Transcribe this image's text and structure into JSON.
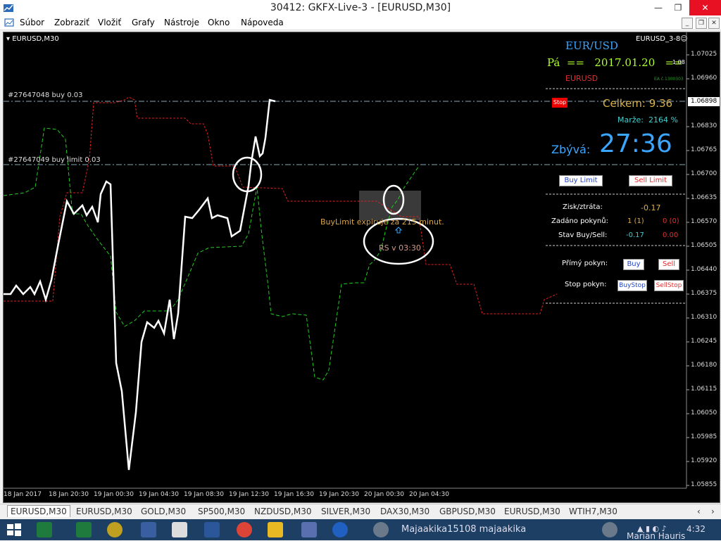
{
  "window": {
    "title": "30412: GKFX-Live-3 - [EURUSD,M30]",
    "minimize": "—",
    "restore": "❐",
    "close": "✕"
  },
  "menu": [
    "Súbor",
    "Zobraziť",
    "Vložiť",
    "Grafy",
    "Nástroje",
    "Okno",
    "Nápoveda"
  ],
  "chart": {
    "symbol_label": "EURUSD,M30",
    "ea_name": "EURUSD_3-8☺",
    "order1": "#27647048 buy 0.03",
    "order2": "#27647049 buy limit 0.03",
    "current_price": "1.06898",
    "stop_label": "Stop",
    "expiry_text": "BuyLimit expiruje za 215 minut.",
    "rs_text": "RS v 03:30",
    "colors": {
      "white_line": "#ffffff",
      "green_line": "#22cc22",
      "red_line": "#dd2222"
    }
  },
  "price_axis": [
    "1.07025",
    "1.06960",
    "1.06898",
    "1.06830",
    "1.06765",
    "1.06700",
    "1.06635",
    "1.06570",
    "1.06505",
    "1.06440",
    "1.06375",
    "1.06310",
    "1.06245",
    "1.06180",
    "1.06115",
    "1.06050",
    "1.05985",
    "1.05920",
    "1.05855"
  ],
  "time_axis": [
    "18 Jan 2017",
    "18 Jan 20:30",
    "19 Jan 00:30",
    "19 Jan 04:30",
    "19 Jan 08:30",
    "19 Jan 12:30",
    "19 Jan 16:30",
    "19 Jan 20:30",
    "20 Jan 00:30",
    "20 Jan 04:30"
  ],
  "panel": {
    "pair": "EUR/USD",
    "day": "Pá",
    "eq1": "==",
    "date": "2017.01.20",
    "eq2": "==",
    "small_value": "1.08",
    "symbol": "EURUSD",
    "ea_no": "EA č.1300303",
    "celkem_label": "Celkem:",
    "celkem_value": "9.36",
    "marze_label": "Marže:",
    "marze_value": "2164 %",
    "zbyva_label": "Zbývá:",
    "zbyva_value": "27:36",
    "buy_limit": "Buy Limit",
    "sell_limit": "Sell Limit",
    "zisk_label": "Zisk/ztráta:",
    "zisk_value": "-0.17",
    "zadano_label": "Zadáno pokynů:",
    "zadano_buy": "1 (1)",
    "zadano_sell": "0 (0)",
    "stav_label": "Stav Buy/Sell:",
    "stav_buy": "-0.17",
    "stav_sell": "0.00",
    "primy_label": "Přímý pokyn:",
    "buy": "Buy",
    "sell": "Sell",
    "stop_label": "Stop pokyn:",
    "buystop": "BuyStop",
    "sellstop": "SellStop"
  },
  "tabs": [
    "EURUSD,M30",
    "EURUSD,M30",
    "GOLD,M30",
    "SP500,M30",
    "NZDUSD,M30",
    "SILVER,M30",
    "DAX30,M30",
    "GBPUSD,M30",
    "EURUSD,M30",
    "WTIH7,M30"
  ],
  "taskbar": {
    "user_text": "Majaakika15108 majaakika",
    "user2": "Marian Hauris",
    "clock": "4:32"
  }
}
